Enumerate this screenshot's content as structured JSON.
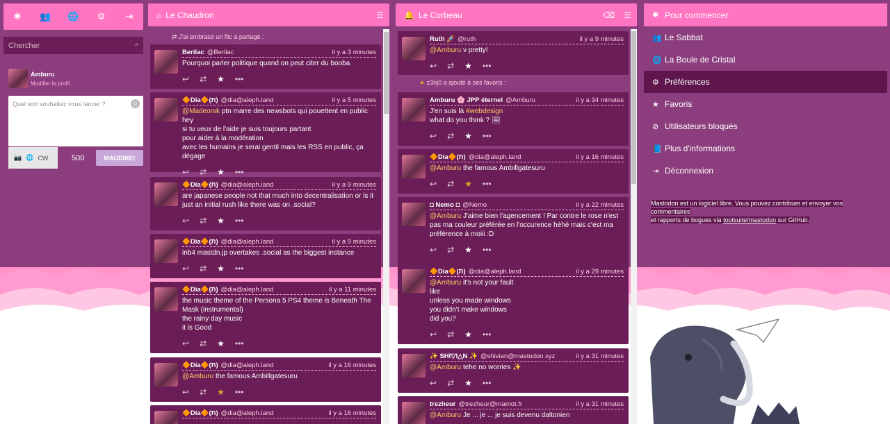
{
  "compose": {
    "nav_icons": [
      "asterisk-icon",
      "users-icon",
      "globe-icon",
      "gear-icon",
      "logout-icon"
    ],
    "search_placeholder": "Chercher",
    "profile": {
      "name": "Amburu",
      "edit_label": "Modifier le profil"
    },
    "textarea_placeholder": "Quel sort souhaitez vous lancer ?",
    "cw_label": "CW",
    "char_count": "500",
    "submit_label": "MAUDIRE!"
  },
  "col1": {
    "title": "Le Chaudron",
    "boost": {
      "text": "J'ai embrasé un flic",
      "suffix": "a partagé :"
    },
    "statuses": [
      {
        "name": "Berilac",
        "acct": "@Berilac",
        "time": "il y a 3 minutes",
        "lines": [
          "Pourquoi parler politique quand on peut citer du booba"
        ]
      },
      {
        "name": "🔶Dia🔶(ת)",
        "acct": "@dia@aleph.land",
        "time": "il y a 5 minutes",
        "lines": [
          "ptn marre des newsbots qui pouettent en public",
          "si tu veux de l'aide je suis toujours partant",
          "pour aider à la modération",
          "avec les humains je serai gentil mais les RSS en public, ça",
          "dégage"
        ],
        "mention": "@Madeorsk",
        "mention_prefix": "hey "
      },
      {
        "name": "🔶Dia🔶(ת)",
        "acct": "@dia@aleph.land",
        "time": "il y a 9 minutes",
        "lines": [
          "are japanese people not that much into decentralisation or is it",
          "just an initial rush like there was on .social?"
        ]
      },
      {
        "name": "🔶Dia🔶(ת)",
        "acct": "@dia@aleph.land",
        "time": "il y a 9 minutes",
        "lines": [
          "inb4 mastdn.jp overtakes .social as the biggest instance"
        ]
      },
      {
        "name": "🔶Dia🔶(ת)",
        "acct": "@dia@aleph.land",
        "time": "il y a 11 minutes",
        "lines": [
          "the music theme of the Persona 5 PS4 theme is Beneath The",
          "Mask (instrumental)",
          "the rainy day music",
          "it is Good"
        ]
      },
      {
        "name": "🔶Dia🔶(ת)",
        "acct": "@dia@aleph.land",
        "time": "il y a 16 minutes",
        "mention": "@Amburu",
        "lines": [
          "the famous Ambillgatesuru"
        ]
      },
      {
        "name": "🔶Dia🔶(ת)",
        "acct": "@dia@aleph.land",
        "time": "il y a 16 minutes",
        "lines": [
          ""
        ]
      }
    ]
  },
  "col2": {
    "title": "Le Corbeau",
    "fav_notice": "z3nj0 a ajouté à ses favoris :",
    "statuses": [
      {
        "name": "Ruth 🚀",
        "acct": "@ruth",
        "time": "il y a 9 minutes",
        "mention": "@Amburu",
        "lines": [
          "v pretty!"
        ]
      },
      {
        "name": "Amburu 🌸 JPP éternel",
        "acct": "@Amburu",
        "time": "il y a 34 minutes",
        "lines": [
          "J'en suis là",
          "what do you think ? 🖼"
        ],
        "hashtag": "#webdesign"
      },
      {
        "name": "🔶Dia🔶(ת)",
        "acct": "@dia@aleph.land",
        "time": "il y a 16 minutes",
        "mention": "@Amburu",
        "lines": [
          "the famous Ambillgatesuru"
        ]
      },
      {
        "name": "◘ Nemo ◘",
        "acct": "@Nemo",
        "time": "il y a 22 minutes",
        "mention": "@Amburu",
        "lines": [
          "J'aime bien l'agencement ! Par contre le rose n'est",
          "pas ma couleur préférée en l'occurence héhé mais c'est ma",
          "préférence à moiii :D"
        ]
      },
      {
        "name": "🔶Dia🔶(ת)",
        "acct": "@dia@aleph.land",
        "time": "il y a 29 minutes",
        "mention": "@Amburu",
        "lines": [
          "it's not your fault",
          "like",
          "unless you made windows",
          "you didn't make windows",
          "did you?"
        ]
      },
      {
        "name": "✨ SHI▽I△N ✨",
        "acct": "@shivian@mastodon.xyz",
        "time": "il y a 31 minutes",
        "mention": "@Amburu",
        "lines": [
          "tehe no worries ✨"
        ]
      },
      {
        "name": "trezheur",
        "acct": "@trezheur@mamot.fr",
        "time": "il y a 31 minutes",
        "mention": "@Amburu",
        "lines": [
          "Je ... je ... je suis devenu daltonien"
        ]
      }
    ]
  },
  "nav": {
    "items": [
      {
        "icon": "asterisk-icon",
        "glyph": "✱",
        "label": "Pour commencer"
      },
      {
        "icon": "users-icon",
        "glyph": "👥",
        "label": "Le Sabbat"
      },
      {
        "icon": "globe-icon",
        "glyph": "🌐",
        "label": "La Boule de Cristal"
      },
      {
        "icon": "gear-icon",
        "glyph": "⚙",
        "label": "Préférences"
      },
      {
        "icon": "star-icon",
        "glyph": "★",
        "label": "Favoris"
      },
      {
        "icon": "ban-icon",
        "glyph": "⊘",
        "label": "Utilisateurs bloqués"
      },
      {
        "icon": "book-icon",
        "glyph": "📘",
        "label": "Plus d'informations"
      },
      {
        "icon": "logout-icon",
        "glyph": "⇥",
        "label": "Déconnexion"
      }
    ],
    "footer_1": "Mastodon est un logiciel libre. Vous pouvez contribuer et envoyer vos commentaires",
    "footer_2": "et rapports de bogues via",
    "footer_link": "tootsuite/mastodon",
    "footer_3": "sur GitHub."
  },
  "colors": {
    "accent": "#ff75c2",
    "background": "#8b3d7d",
    "card": "#6a1d56",
    "mention": "#ffd066",
    "fav_on": "#e6a42e"
  }
}
